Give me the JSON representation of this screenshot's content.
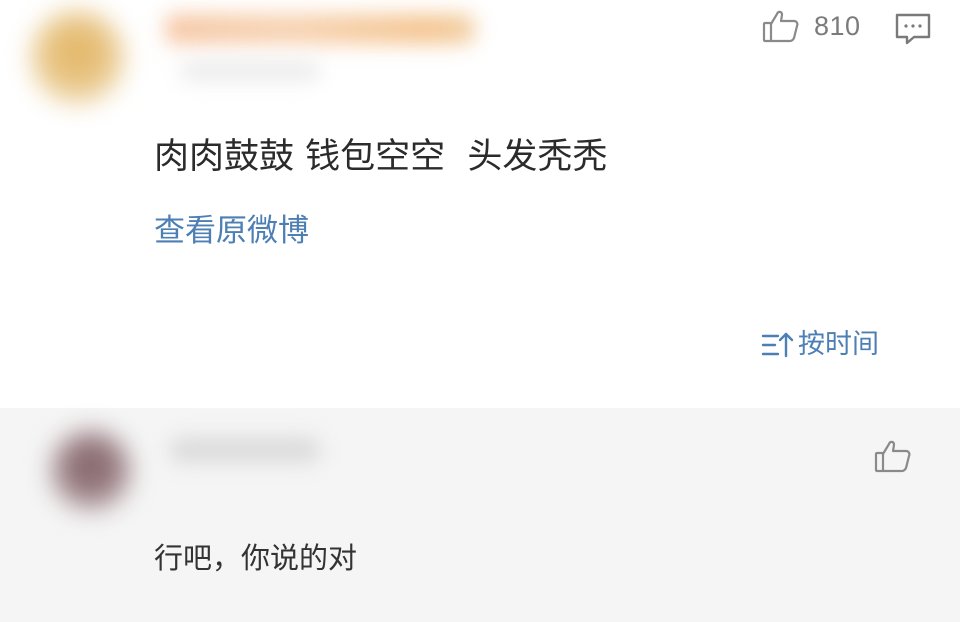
{
  "top_comment": {
    "like_count": "810",
    "text": "肉肉鼓鼓 钱包空空  头发秃秃",
    "view_original_label": "查看原微博",
    "sort_label": "按时间"
  },
  "reply": {
    "text": "行吧，你说的对"
  },
  "icons": {
    "like": "thumbs-up-icon",
    "reply": "comment-bubble-icon",
    "sort": "sort-icon"
  },
  "colors": {
    "link": "#4d7fb5",
    "text": "#2b2b2b",
    "muted": "#7b7b7b",
    "reply_background": "#f5f5f5"
  }
}
